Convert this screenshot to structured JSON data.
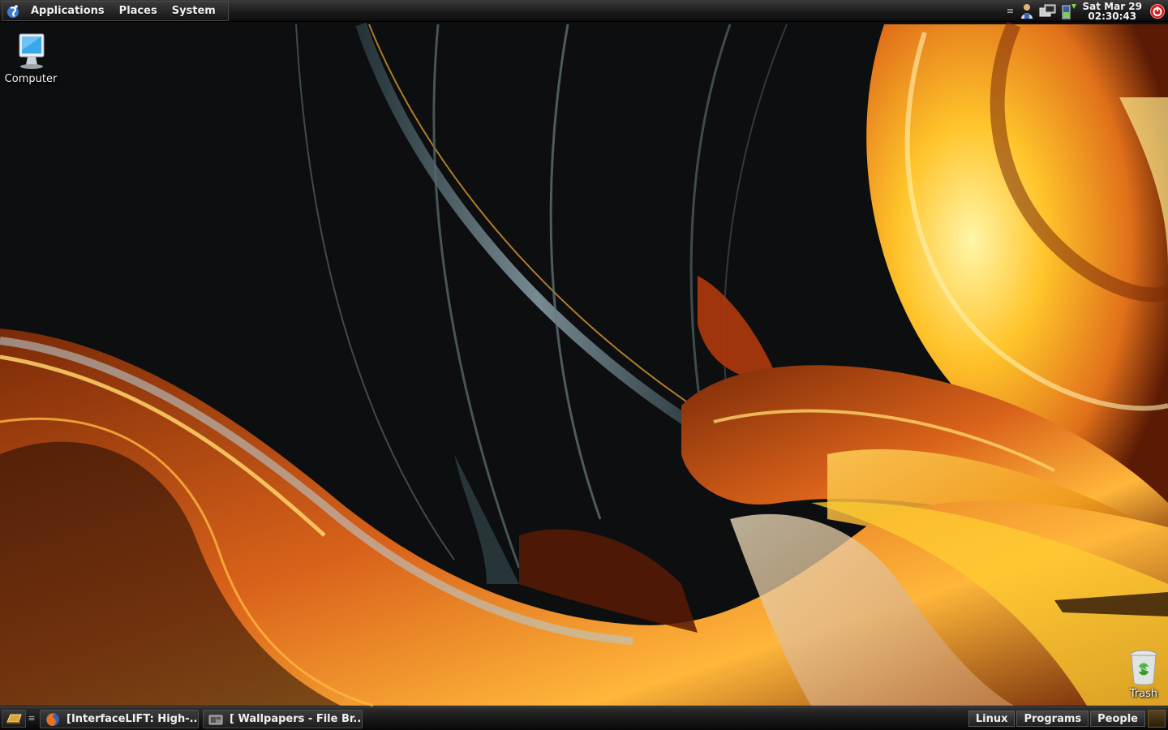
{
  "top_panel": {
    "menus": [
      "Applications",
      "Places",
      "System"
    ],
    "clock": {
      "date": "Sat Mar 29",
      "time": "02:30:43"
    }
  },
  "desktop": {
    "icons": [
      {
        "label": "Computer",
        "icon": "computer-icon"
      },
      {
        "label": "Trash",
        "icon": "trash-icon"
      }
    ]
  },
  "bottom_panel": {
    "tasks": [
      {
        "label": "[InterfaceLIFT: High-...",
        "icon": "firefox-icon"
      },
      {
        "label": "[ Wallpapers - File Br...",
        "icon": "file-browser-icon"
      }
    ],
    "workspaces": [
      "Linux",
      "Programs",
      "People"
    ]
  },
  "colors": {
    "panel_bg": "#1a1a1a",
    "wallpaper_bg": "#0c0c0c",
    "accent_orange": "#e88a1a",
    "accent_gold": "#ffc62a",
    "power_red": "#d21b1b"
  }
}
